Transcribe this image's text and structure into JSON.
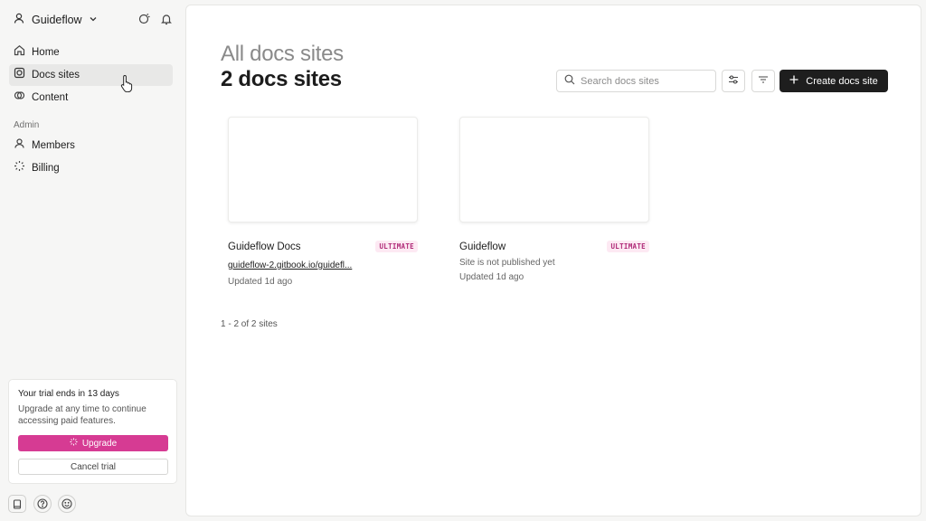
{
  "sidebar": {
    "org_name": "Guideflow",
    "nav": [
      {
        "label": "Home",
        "icon": "home-icon"
      },
      {
        "label": "Docs sites",
        "icon": "docs-sites-icon",
        "active": true
      },
      {
        "label": "Content",
        "icon": "content-icon"
      }
    ],
    "section_label": "Admin",
    "admin_nav": [
      {
        "label": "Members",
        "icon": "members-icon"
      },
      {
        "label": "Billing",
        "icon": "billing-icon"
      }
    ],
    "trial": {
      "title": "Your trial ends in 13 days",
      "description": "Upgrade at any time to continue accessing paid features.",
      "upgrade_label": "Upgrade",
      "cancel_label": "Cancel trial"
    }
  },
  "main": {
    "supertitle": "All docs sites",
    "title": "2 docs sites",
    "search_placeholder": "Search docs sites",
    "create_label": "Create docs site",
    "sites": [
      {
        "name": "Guideflow Docs",
        "badge": "ULTIMATE",
        "link": "guideflow-2.gitbook.io/guidefl...",
        "updated": "Updated 1d ago"
      },
      {
        "name": "Guideflow",
        "badge": "ULTIMATE",
        "status": "Site is not published yet",
        "updated": "Updated 1d ago"
      }
    ],
    "pagination": "1 - 2 of 2 sites"
  },
  "colors": {
    "accent": "#d63b93",
    "primary_button": "#1e1e1e",
    "badge_text": "#b02a78",
    "badge_bg": "#fde9f3"
  }
}
